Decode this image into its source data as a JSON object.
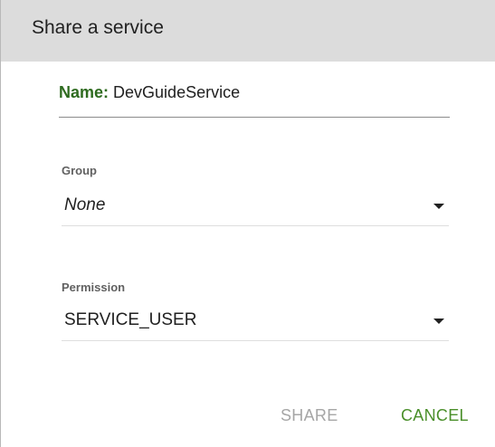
{
  "dialog": {
    "title": "Share a service",
    "name_label": "Name:",
    "name_value": "DevGuideService",
    "group": {
      "label": "Group",
      "selected": "None"
    },
    "permission": {
      "label": "Permission",
      "selected": "SERVICE_USER"
    },
    "actions": {
      "share_label": "SHARE",
      "cancel_label": "CANCEL"
    }
  },
  "colors": {
    "header_bg": "#dcdcdc",
    "name_label": "#2e6b1f",
    "cancel_button": "#4a8f2a",
    "share_button_disabled": "#a6a6a6"
  },
  "icons": {
    "dropdown": "caret-down-icon"
  }
}
